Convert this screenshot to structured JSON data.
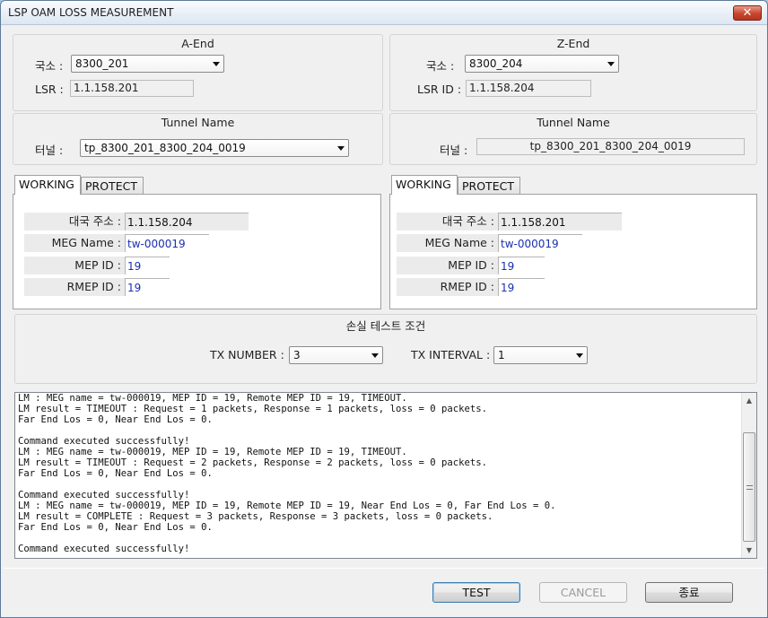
{
  "window": {
    "title": "LSP OAM LOSS MEASUREMENT",
    "close_label": "✕"
  },
  "a_end": {
    "title": "A-End",
    "station_label": "국소 :",
    "station_value": "8300_201",
    "lsr_label": "LSR :",
    "lsr_value": "1.1.158.201"
  },
  "z_end": {
    "title": "Z-End",
    "station_label": "국소 :",
    "station_value": "8300_204",
    "lsr_label": "LSR ID :",
    "lsr_value": "1.1.158.204"
  },
  "tunnel_a": {
    "title": "Tunnel Name",
    "label": "터널 :",
    "value": "tp_8300_201_8300_204_0019"
  },
  "tunnel_z": {
    "title": "Tunnel Name",
    "label": "터널 :",
    "value": "tp_8300_201_8300_204_0019"
  },
  "left_tabs": {
    "tabs": [
      {
        "label": "WORKING",
        "active": true
      },
      {
        "label": "PROTECT",
        "active": false
      }
    ],
    "rows": [
      {
        "label": "대국 주소 :",
        "value": "1.1.158.204"
      },
      {
        "label": "MEG Name :",
        "value": "tw-000019"
      },
      {
        "label": "MEP ID :",
        "value": "19"
      },
      {
        "label": "RMEP ID :",
        "value": "19"
      }
    ]
  },
  "right_tabs": {
    "tabs": [
      {
        "label": "WORKING",
        "active": true
      },
      {
        "label": "PROTECT",
        "active": false
      }
    ],
    "rows": [
      {
        "label": "대국 주소 :",
        "value": "1.1.158.201"
      },
      {
        "label": "MEG Name :",
        "value": "tw-000019"
      },
      {
        "label": "MEP ID :",
        "value": "19"
      },
      {
        "label": "RMEP ID :",
        "value": "19"
      }
    ]
  },
  "loss_test": {
    "title": "손실 테스트 조건",
    "tx_number_label": "TX NUMBER :",
    "tx_number_value": "3",
    "tx_interval_label": "TX INTERVAL :",
    "tx_interval_value": "1"
  },
  "log": {
    "text": "LM : MEG name = tw-000019, MEP ID = 19, Remote MEP ID = 19, TIMEOUT.\nLM result = TIMEOUT : Request = 1 packets, Response = 1 packets, loss = 0 packets.\nFar End Los = 0, Near End Los = 0.\n\nCommand executed successfully!\nLM : MEG name = tw-000019, MEP ID = 19, Remote MEP ID = 19, TIMEOUT.\nLM result = TIMEOUT : Request = 2 packets, Response = 2 packets, loss = 0 packets.\nFar End Los = 0, Near End Los = 0.\n\nCommand executed successfully!\nLM : MEG name = tw-000019, MEP ID = 19, Remote MEP ID = 19, Near End Los = 0, Far End Los = 0.\nLM result = COMPLETE : Request = 3 packets, Response = 3 packets, loss = 0 packets.\nFar End Los = 0, Near End Los = 0.\n\nCommand executed successfully!"
  },
  "buttons": {
    "test": "TEST",
    "cancel": "CANCEL",
    "close": "종료"
  }
}
